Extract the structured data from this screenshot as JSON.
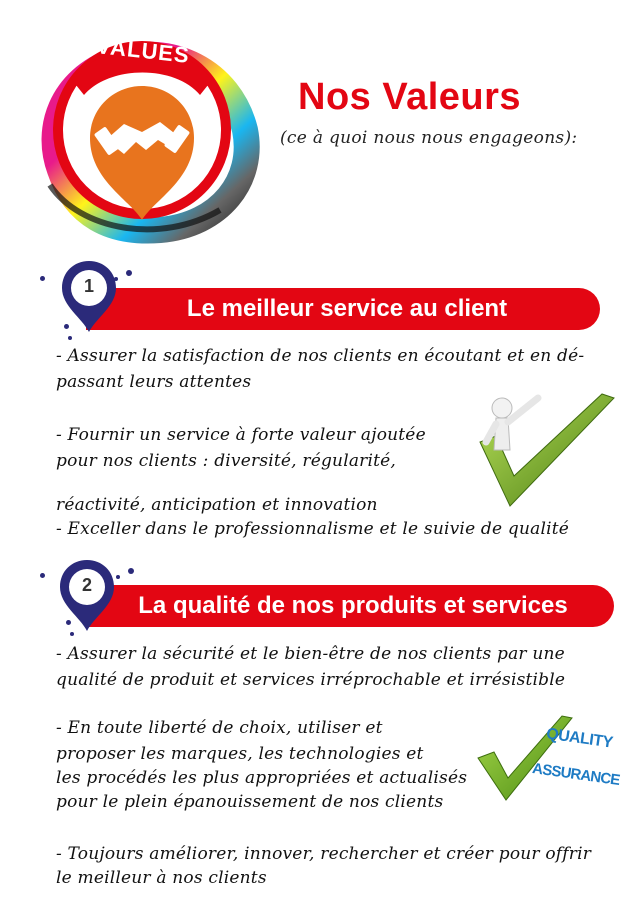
{
  "header": {
    "badge_text": "VALUES",
    "title": "Nos Valeurs",
    "subtitle": "(ce à quoi nous nous engageons):"
  },
  "sections": [
    {
      "number": "1",
      "heading": "Le meilleur service au client",
      "lines": [
        "- Assurer la satisfaction de nos clients en écoutant et en dé-",
        "passant leurs attentes",
        "- Fournir un service à forte valeur ajoutée",
        " pour nos clients : diversité, régularité,",
        "réactivité, anticipation et innovation",
        "- Exceller dans le professionnalisme et le suivie de qualité"
      ]
    },
    {
      "number": "2",
      "heading": "La qualité de nos produits et services",
      "lines": [
        "- Assurer la sécurité et le bien-être de nos clients par une",
        "qualité de produit et services irréprochable et irrésistible",
        "- En toute liberté de choix, utiliser et",
        "proposer les marques, les technologies et",
        "les procédés les plus appropriées et actualisés",
        "pour le plein épanouissement de nos clients",
        "- Toujours améliorer, innover, rechercher et créer pour offrir",
        "le meilleur à nos clients"
      ]
    }
  ],
  "quality_badge": {
    "line1": "QUALITY",
    "line2": "ASSURANCE"
  },
  "colors": {
    "accent": "#e30613",
    "navy": "#2b2a7a",
    "orange": "#e8741e",
    "check_green": "#6aa022"
  },
  "icons": {
    "logo": "handshake-icon",
    "section1_illustration": "person-checkmark-icon",
    "section2_illustration": "green-checkmark-icon"
  }
}
